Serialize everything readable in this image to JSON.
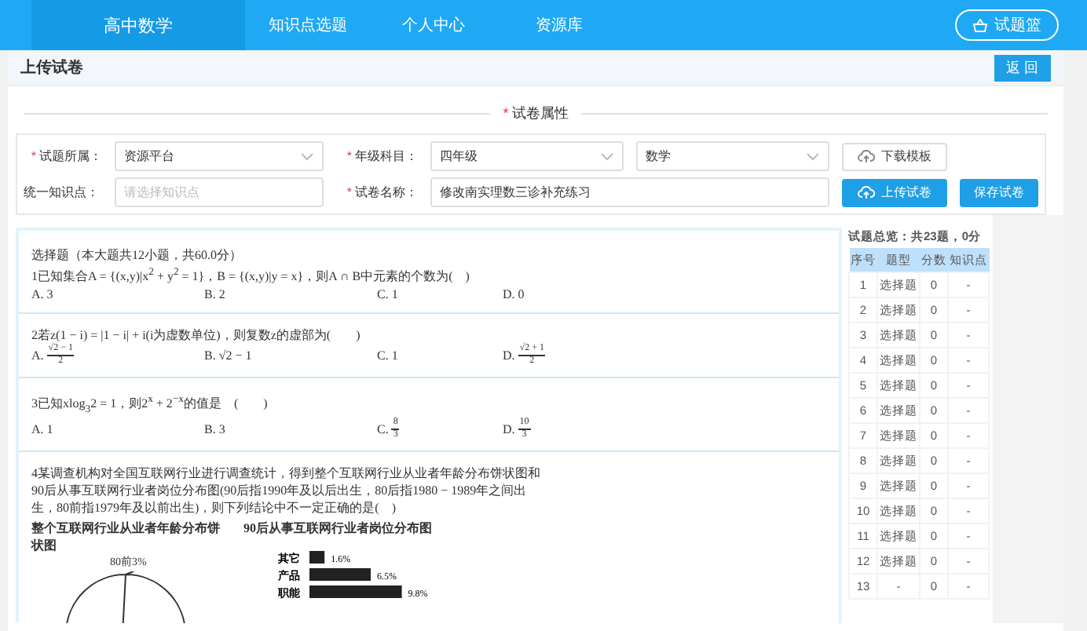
{
  "nav": {
    "brand": "高中数学",
    "items": [
      {
        "label": "知识点选题",
        "selected": false
      },
      {
        "label": "个人中心",
        "selected": false
      },
      {
        "label": "资源库",
        "selected": false
      }
    ],
    "basket": "试题篮"
  },
  "header": {
    "title": "上传试卷",
    "back": "返 回"
  },
  "section_title": {
    "mark": "*",
    "text": "试卷属性"
  },
  "form": {
    "source_label": {
      "mark": "*",
      "text": "试题所属："
    },
    "source_value": "资源平台",
    "grade_label": {
      "mark": "*",
      "text": "年级科目："
    },
    "grade_value": "四年级",
    "subject_value": "数学",
    "knowledge_label": "统一知识点：",
    "knowledge_placeholder": "请选择知识点",
    "name_label": {
      "mark": "*",
      "text": "试卷名称："
    },
    "name_value": "修改南实理数三诊补充练习",
    "download": "下载模板",
    "upload": "上传试卷",
    "save": "保存试卷"
  },
  "questions": [
    {
      "heading": "选择题（本大题共12小题，共60.0分）",
      "text": "1已知集合A = {(x,y)|x$^{2}$ + y$^{2}$ = 1}，B = {(x,y)|y = x}，则A ∩ B中元素的个数为(　)",
      "options": [
        {
          "kind": "text",
          "letter": "A.",
          "text": "3"
        },
        {
          "kind": "text",
          "letter": "B.",
          "text": "2"
        },
        {
          "kind": "text",
          "letter": "C.",
          "text": "1"
        },
        {
          "kind": "text",
          "letter": "D.",
          "text": "0"
        }
      ]
    },
    {
      "text": "2若z(1 − i) = |1 − i| + i(i为虚数单位)，则复数z的虚部为(　　)",
      "options": [
        {
          "kind": "fraction",
          "letter": "A.",
          "num": "√2 − 1",
          "den": "2"
        },
        {
          "kind": "text",
          "letter": "B.",
          "text": "√2 − 1"
        },
        {
          "kind": "text",
          "letter": "C.",
          "text": "1"
        },
        {
          "kind": "fraction",
          "letter": "D.",
          "num": "√2 + 1",
          "den": "2"
        }
      ]
    },
    {
      "text": "3已知xlog$_{3}$2 = 1，则2$^{x}$ + 2$^{−x}$的值是　(　　)",
      "options": [
        {
          "kind": "text",
          "letter": "A.",
          "text": "1"
        },
        {
          "kind": "text",
          "letter": "B.",
          "text": "3"
        },
        {
          "kind": "fraction",
          "letter": "C.",
          "num": "8",
          "den": "3"
        },
        {
          "kind": "fraction",
          "letter": "D.",
          "num": "10",
          "den": "3"
        }
      ]
    },
    {
      "text": "4某调查机构对全国互联网行业进行调查统计，得到整个互联网行业从业者年龄分布饼状图和90后从事互联网行业者岗位分布图(90后指1990年及以后出生，80后指1980 − 1989年之间出生，80前指1979年及以前出生)，则下列结论中不一定正确的是(　)",
      "figure": {
        "pie_title": "整个互联网行业从业者年龄分布饼状图",
        "pie_label": "80前3%",
        "bar_title": "90后从事互联网行业者岗位分布图",
        "chart_data": {
          "type": "bar",
          "orientation": "horizontal",
          "categories": [
            "其它",
            "产品",
            "职能"
          ],
          "values": [
            1.6,
            6.5,
            9.8
          ],
          "value_labels": [
            "1.6%",
            "6.5%",
            "9.8%"
          ]
        }
      }
    }
  ],
  "summary": "试题总览：共23题，0分",
  "table": {
    "columns": [
      "序号",
      "题型",
      "分数",
      "知识点"
    ],
    "rows": [
      [
        "1",
        "选择题",
        "0",
        "-"
      ],
      [
        "2",
        "选择题",
        "0",
        "-"
      ],
      [
        "3",
        "选择题",
        "0",
        "-"
      ],
      [
        "4",
        "选择题",
        "0",
        "-"
      ],
      [
        "5",
        "选择题",
        "0",
        "-"
      ],
      [
        "6",
        "选择题",
        "0",
        "-"
      ],
      [
        "7",
        "选择题",
        "0",
        "-"
      ],
      [
        "8",
        "选择题",
        "0",
        "-"
      ],
      [
        "9",
        "选择题",
        "0",
        "-"
      ],
      [
        "10",
        "选择题",
        "0",
        "-"
      ],
      [
        "11",
        "选择题",
        "0",
        "-"
      ],
      [
        "12",
        "选择题",
        "0",
        "-"
      ],
      [
        "13",
        "-",
        "0",
        "-"
      ]
    ]
  }
}
